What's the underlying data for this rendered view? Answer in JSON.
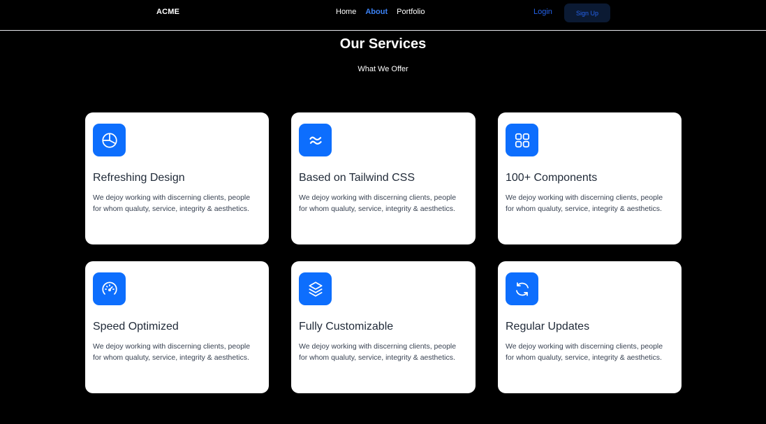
{
  "nav": {
    "brand": "ACME",
    "links": [
      {
        "label": "Home",
        "active": false
      },
      {
        "label": "About",
        "active": true
      },
      {
        "label": "Portfolio",
        "active": false
      }
    ],
    "login_label": "Login",
    "signup_label": "Sign Up"
  },
  "colors": {
    "accent": "#0d6efd",
    "active_link": "#3b82f6",
    "background": "#000000",
    "card": "#ffffff"
  },
  "section": {
    "title": "Our Services",
    "subtitle": "What We Offer"
  },
  "services": [
    {
      "icon": "pie-chart-icon",
      "title": "Refreshing Design",
      "description": "We dejoy working with discerning clients, people for whom qualuty, service, integrity & aesthetics."
    },
    {
      "icon": "tailwind-icon",
      "title": "Based on Tailwind CSS",
      "description": "We dejoy working with discerning clients, people for whom qualuty, service, integrity & aesthetics."
    },
    {
      "icon": "grid-icon",
      "title": "100+ Components",
      "description": "We dejoy working with discerning clients, people for whom qualuty, service, integrity & aesthetics."
    },
    {
      "icon": "speedometer-icon",
      "title": "Speed Optimized",
      "description": "We dejoy working with discerning clients, people for whom qualuty, service, integrity & aesthetics."
    },
    {
      "icon": "layers-icon",
      "title": "Fully Customizable",
      "description": "We dejoy working with discerning clients, people for whom qualuty, service, integrity & aesthetics."
    },
    {
      "icon": "refresh-icon",
      "title": "Regular Updates",
      "description": "We dejoy working with discerning clients, people for whom qualuty, service, integrity & aesthetics."
    }
  ]
}
